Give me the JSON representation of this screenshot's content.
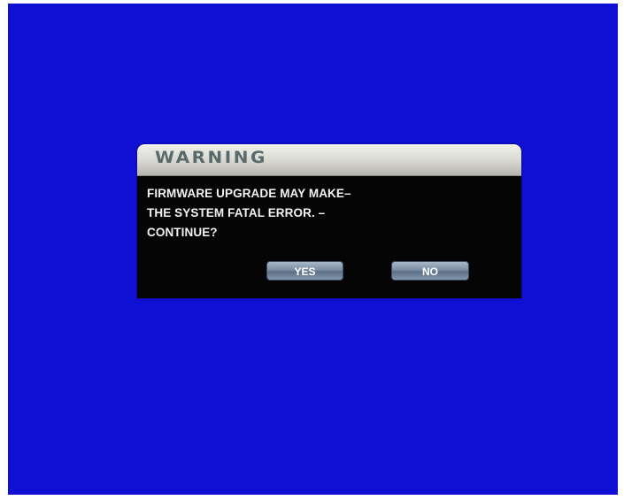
{
  "dialog": {
    "title": "WARNING",
    "message_lines": [
      "FIRMWARE UPGRADE MAY MAKE–",
      "THE SYSTEM FATAL ERROR. –",
      "CONTINUE?"
    ],
    "buttons": {
      "yes_label": "YES",
      "no_label": "NO"
    }
  },
  "colors": {
    "background": "#1010d4",
    "dialog_body": "#050505",
    "titlebar": "#d7d7d0",
    "button": "#7c8ea3"
  }
}
